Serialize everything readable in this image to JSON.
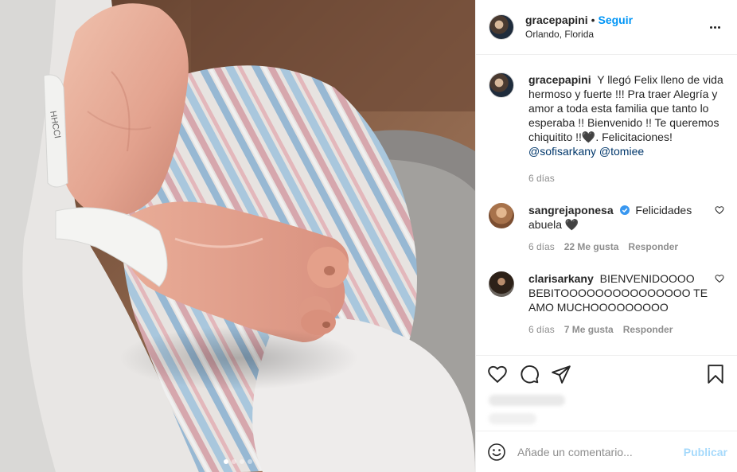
{
  "post": {
    "owner": {
      "username": "gracepapini",
      "separator": "•",
      "follow_label": "Seguir",
      "location": "Orlando, Florida",
      "avatar_icon": "profile-photo-icon",
      "more_icon": "more-options-icon"
    },
    "caption": {
      "username": "gracepapini",
      "text": "Y llegó Felix lleno de vida hermoso y fuerte !!! Pra traer Alegría y amor a toda esta familia que tanto lo esperaba !! Bienvenido !! Te queremos chiquitito !!🖤. Felicitaciones!",
      "mentions": [
        "@sofisarkany",
        "@tomiee"
      ],
      "time": "6 días"
    },
    "comments": [
      {
        "username": "sangrejaponesa",
        "verified": true,
        "text": "Felicidades abuela 🖤",
        "time": "6 días",
        "likes": "22 Me gusta",
        "reply_label": "Responder"
      },
      {
        "username": "clarisarkany",
        "verified": false,
        "text": "BIENVENIDOOOO BEBITOOOOOOOOOOOOOOO TE AMO MUCHOOOOOOOOO",
        "time": "6 días",
        "likes": "7 Me gusta",
        "reply_label": "Responder"
      }
    ],
    "actions": {
      "icons": [
        "heart-icon",
        "comment-icon",
        "share-icon",
        "bookmark-icon"
      ]
    },
    "add_comment": {
      "placeholder": "Añade un comentario...",
      "publish_label": "Publicar",
      "emoji_icon": "emoji-icon"
    },
    "carousel": {
      "count": 4,
      "active_index": 0
    },
    "colors": {
      "link": "#0095f6",
      "text": "#262626",
      "muted": "#8e8e8e",
      "border": "#efefef"
    }
  }
}
